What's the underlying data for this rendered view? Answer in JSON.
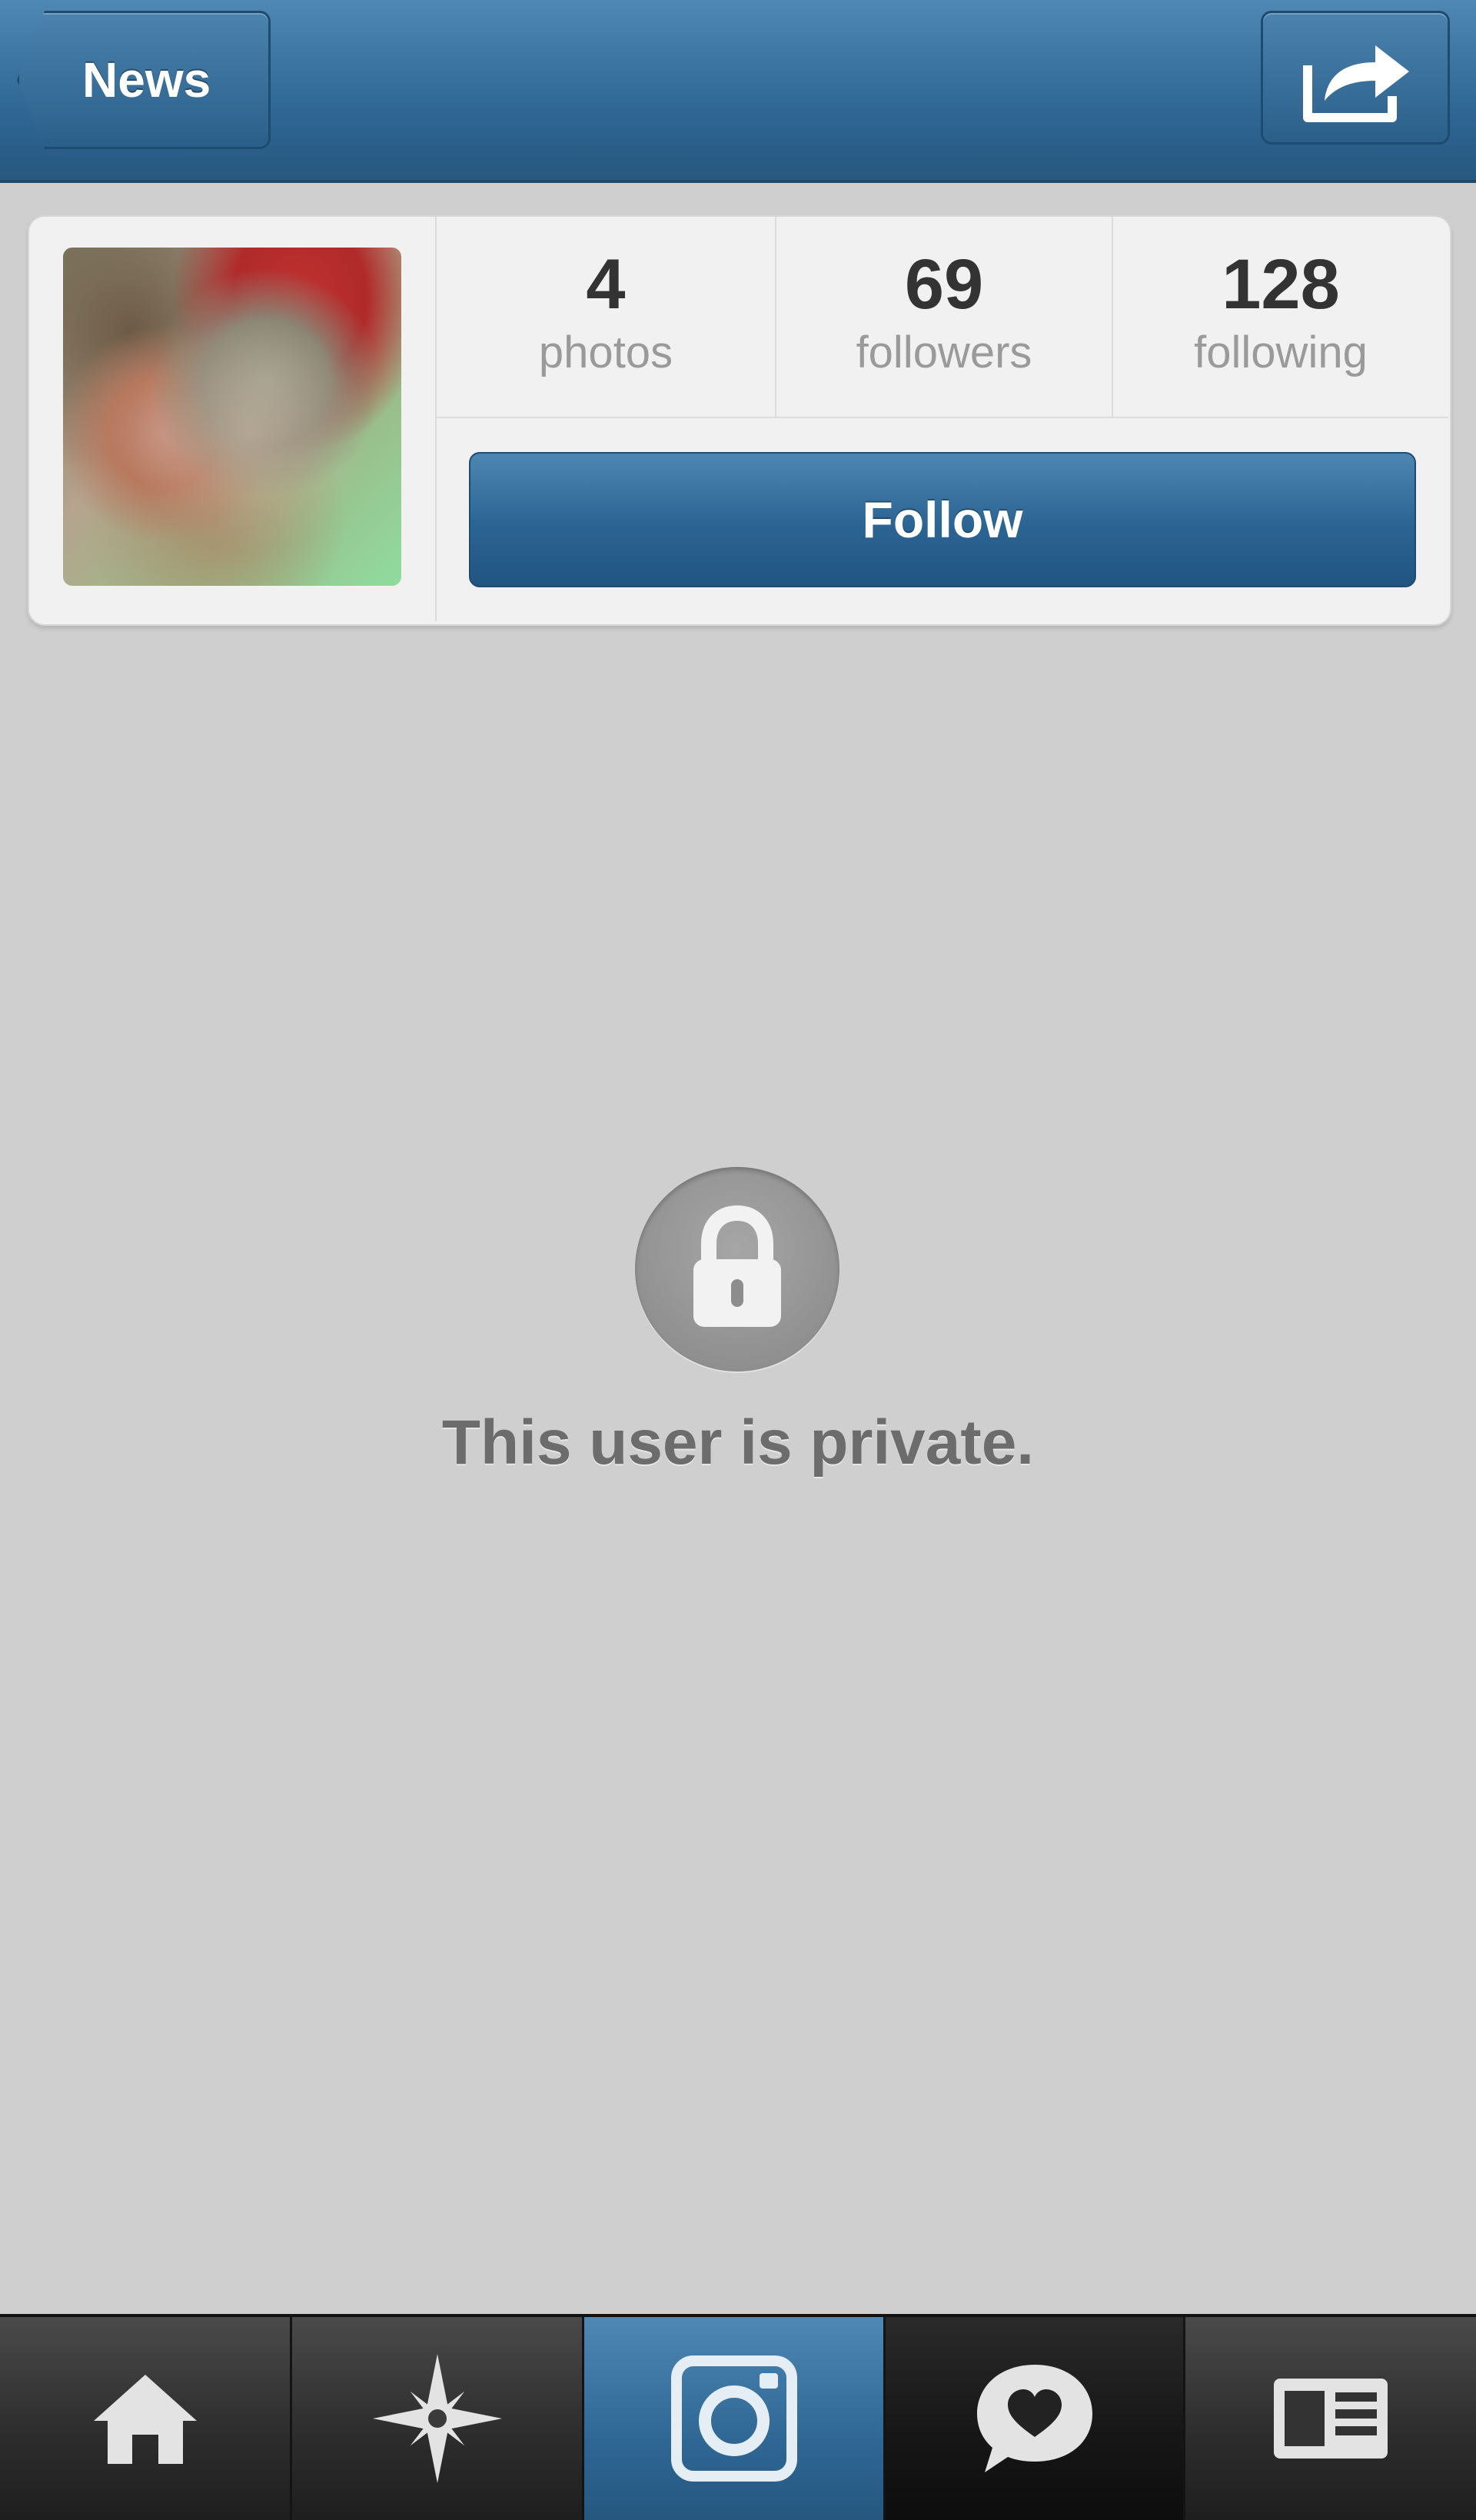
{
  "header": {
    "back_label": "News",
    "share_icon": "share-icon"
  },
  "profile": {
    "avatar_icon": "avatar",
    "stats": [
      {
        "value": "4",
        "label": "photos"
      },
      {
        "value": "69",
        "label": "followers"
      },
      {
        "value": "128",
        "label": "following"
      }
    ],
    "follow_label": "Follow"
  },
  "private": {
    "icon": "lock-icon",
    "message": "This user is private."
  },
  "tabbar": {
    "tabs": [
      {
        "icon": "home-icon"
      },
      {
        "icon": "explore-icon"
      },
      {
        "icon": "camera-icon",
        "active": true
      },
      {
        "icon": "news-heart-icon"
      },
      {
        "icon": "profile-icon"
      }
    ]
  },
  "colors": {
    "accent": "#2f6795",
    "background": "#cfcfcf"
  }
}
